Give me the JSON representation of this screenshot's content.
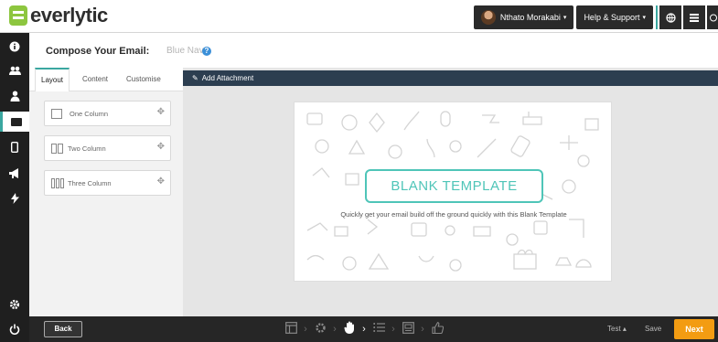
{
  "brand": {
    "name": "everlytic",
    "accent": "#8dc63f"
  },
  "topbar": {
    "user_label": "Nthato Morakabi",
    "help_label": "Help & Support",
    "icons": [
      "globe-icon",
      "grid-icon",
      "chat-icon"
    ]
  },
  "sidebar": {
    "items": [
      {
        "icon": "info-icon",
        "glyph": "❶"
      },
      {
        "icon": "contacts-icon",
        "glyph": "👥"
      },
      {
        "icon": "user-icon",
        "glyph": "👤"
      },
      {
        "icon": "email-icon",
        "glyph": "▬",
        "active": true
      },
      {
        "icon": "mobile-icon",
        "glyph": "▯"
      },
      {
        "icon": "megaphone-icon",
        "glyph": "📣"
      },
      {
        "icon": "bolt-icon",
        "glyph": "⚡"
      },
      {
        "icon": "settings-icon",
        "glyph": "⚙"
      },
      {
        "icon": "power-icon",
        "glyph": "⏻"
      }
    ]
  },
  "compose": {
    "title": "Compose Your Email:",
    "subject": "Blue Nav"
  },
  "left_panel": {
    "tabs": [
      {
        "label": "Layout",
        "active": true
      },
      {
        "label": "Content"
      },
      {
        "label": "Customise"
      }
    ],
    "layouts": [
      {
        "label": "One Column",
        "columns": 1
      },
      {
        "label": "Two Column",
        "columns": 2
      },
      {
        "label": "Three Column",
        "columns": 3
      }
    ]
  },
  "main": {
    "attach_label": "Add Attachment",
    "template_title": "BLANK TEMPLATE",
    "template_desc": "Quickly get your email build off the ground quickly with this Blank Template"
  },
  "bottombar": {
    "back_label": "Back",
    "test_label": "Test",
    "save_label": "Save",
    "next_label": "Next",
    "next_color": "#f39c12",
    "steps": [
      "layout-step-icon",
      "settings-step-icon",
      "hand-step-icon",
      "list-step-icon",
      "preview-step-icon",
      "thumbs-up-step-icon"
    ],
    "current_step": 2
  }
}
